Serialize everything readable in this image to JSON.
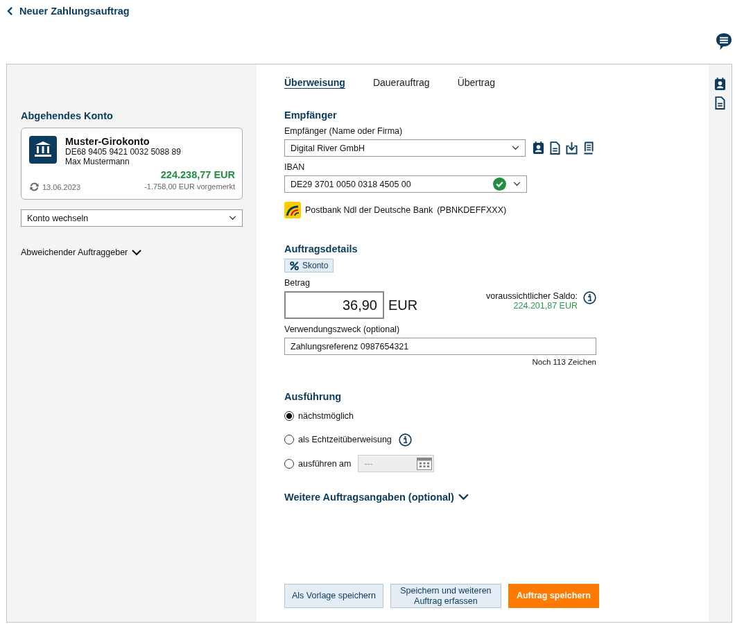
{
  "header": {
    "back_label": "Neuer Zahlungsauftrag"
  },
  "source": {
    "heading": "Abgehendes Konto",
    "account": {
      "name": "Muster-Girokonto",
      "iban": "DE68 9405 9421 0032 5088 89",
      "holder": "Max Mustermann",
      "balance": "224.238,77 EUR",
      "date": "13.06.2023",
      "pending": "-1.758,00 EUR vorgemerkt"
    },
    "switch_select": {
      "value": "Konto wechseln"
    },
    "other_payer": {
      "label": "Abweichender Auftraggeber",
      "expanded": false
    }
  },
  "tabs": [
    {
      "label": "Überweisung",
      "selected": true
    },
    {
      "label": "Dauerauftrag",
      "selected": false
    },
    {
      "label": "Übertrag",
      "selected": false
    }
  ],
  "recipient": {
    "heading": "Empfänger",
    "name_field": {
      "label": "Empfänger (Name oder Firma)",
      "value": "Digital River GmbH"
    },
    "iban_field": {
      "label": "IBAN",
      "value": "DE29 3701 0050 0318 4505 00",
      "valid": true
    },
    "bank": {
      "name": "Postbank Ndl der Deutsche Bank",
      "bic": "(PBNKDEFFXXX)"
    }
  },
  "details": {
    "heading": "Auftragsdetails",
    "discount_button": "Skonto",
    "amount_label": "Betrag",
    "amount": "36,90",
    "currency": "EUR",
    "balance_label": "voraussichtlicher Saldo:",
    "balance": "224.201,87 EUR",
    "purpose_label": "Verwendungszweck (optional)",
    "purpose": "Zahlungsreferenz 0987654321",
    "remaining": "Noch 113 Zeichen"
  },
  "execution": {
    "heading": "Ausführung",
    "options": [
      {
        "kind": "plain",
        "label": "nächstmöglich",
        "selected": true
      },
      {
        "kind": "info",
        "label": "als Echtzeitüberweisung",
        "selected": false
      },
      {
        "kind": "date",
        "label": "ausführen am",
        "selected": false,
        "placeholder": "---"
      }
    ]
  },
  "more": {
    "label": "Weitere Auftragsangaben (optional)",
    "expanded": false
  },
  "buttons": [
    {
      "kind": "secondary",
      "label": "Als Vorlage speichern"
    },
    {
      "kind": "secondary",
      "label": "Speichern und weiteren Auftrag erfassen"
    },
    {
      "kind": "primary",
      "label": "Auftrag speichern"
    }
  ]
}
